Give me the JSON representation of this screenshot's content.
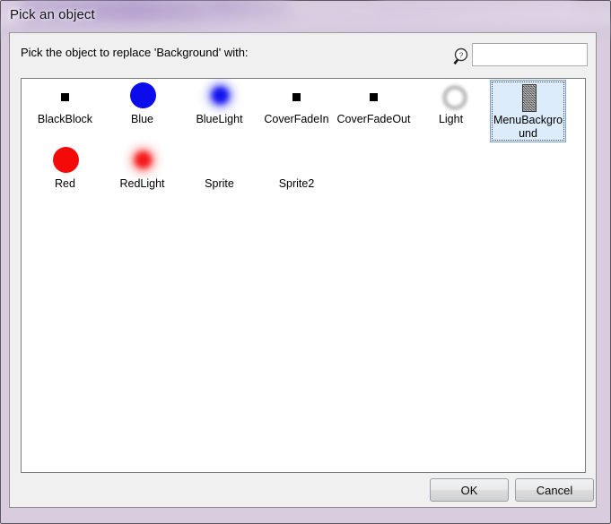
{
  "window": {
    "title": "Pick an object"
  },
  "dialog": {
    "prompt": "Pick the object to replace 'Background' with:",
    "search": {
      "icon": "search-help-icon",
      "value": "",
      "placeholder": ""
    },
    "buttons": {
      "ok_label": "OK",
      "cancel_label": "Cancel"
    }
  },
  "object_list": {
    "rows": [
      {
        "items": [
          {
            "label": "BlackBlock",
            "thumb": "black-square",
            "selected": false
          },
          {
            "label": "Blue",
            "thumb": "blue-circle",
            "selected": false
          },
          {
            "label": "BlueLight",
            "thumb": "blue-glow",
            "selected": false
          },
          {
            "label": "CoverFadeIn",
            "thumb": "black-square",
            "selected": false
          },
          {
            "label": "CoverFadeOut",
            "thumb": "black-square",
            "selected": false
          },
          {
            "label": "Light",
            "thumb": "grey-ring",
            "selected": false
          },
          {
            "label": "MenuBackground",
            "thumb": "noise-tile",
            "selected": true
          }
        ]
      },
      {
        "items": [
          {
            "label": "Red",
            "thumb": "red-circle",
            "selected": false
          },
          {
            "label": "RedLight",
            "thumb": "red-glow",
            "selected": false
          },
          {
            "label": "Sprite",
            "thumb": "none",
            "selected": false
          },
          {
            "label": "Sprite2",
            "thumb": "none",
            "selected": false
          }
        ]
      }
    ]
  },
  "colors": {
    "selection_fill": "#dcecfb",
    "selection_border": "#7da2ce",
    "blue_object": "#0b0bec",
    "red_object": "#f50a0a",
    "glass_border": "#d9cfe1",
    "dialog_background": "#f0f0f0"
  }
}
